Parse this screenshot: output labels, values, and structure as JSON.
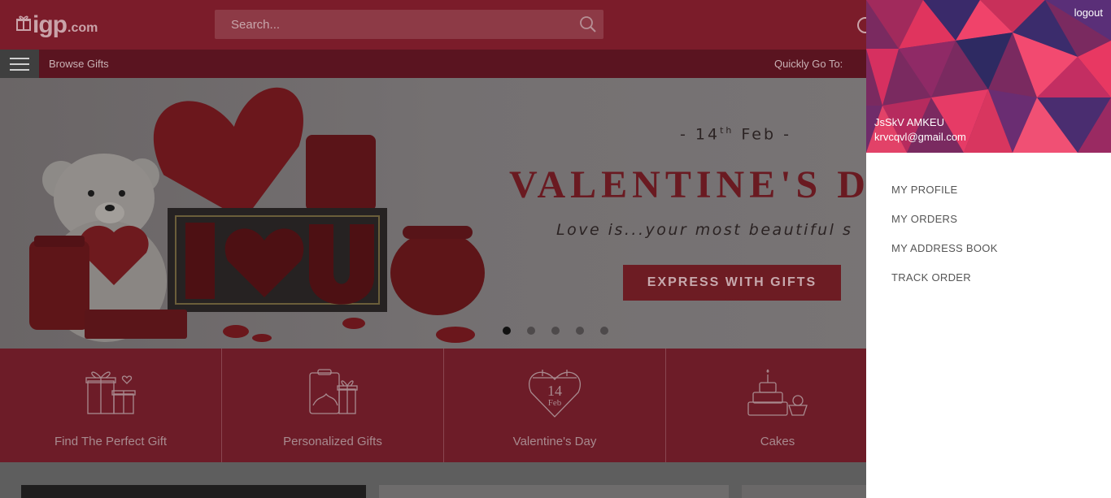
{
  "header": {
    "logo_text": "igp",
    "logo_suffix": ".com",
    "search_placeholder": "Search..."
  },
  "navbar": {
    "browse_label": "Browse Gifts",
    "quick_go_label": "Quickly Go To:"
  },
  "banner": {
    "date_text": "- 14th Feb -",
    "title": "VALENTINE'S D",
    "subtitle": "Love is...your most beautiful s",
    "cta_label": "EXPRESS WITH GIFTS",
    "slide_count": 5,
    "active_slide": 1
  },
  "categories": [
    {
      "label": "Find The Perfect Gift",
      "icon": "gift-boxes-icon"
    },
    {
      "label": "Personalized Gifts",
      "icon": "personalized-gift-icon"
    },
    {
      "label": "Valentine's Day",
      "icon": "calendar-heart-icon",
      "icon_text_day": "14",
      "icon_text_month": "Feb"
    },
    {
      "label": "Cakes",
      "icon": "cake-icon"
    }
  ],
  "user_panel": {
    "logout_label": "logout",
    "user_name": "JsSkV AMKEU",
    "user_email": "krvcqvl@gmail.com",
    "menu": [
      {
        "label": "MY PROFILE"
      },
      {
        "label": "MY ORDERS"
      },
      {
        "label": "MY ADDRESS BOOK"
      },
      {
        "label": "TRACK ORDER"
      }
    ]
  },
  "colors": {
    "brand": "#7b1c2a",
    "overlay_panel": "#ffffff"
  }
}
